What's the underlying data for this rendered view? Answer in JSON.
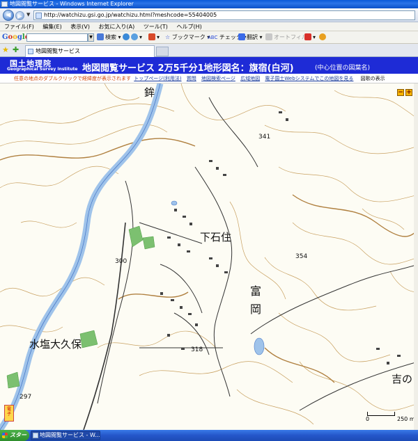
{
  "window": {
    "title": "地図閲覧サービス - Windows Internet Explorer"
  },
  "address": {
    "url": "http://watchizu.gsi.go.jp/watchizu.html?meshcode=55404005"
  },
  "menu": [
    "ファイル(F)",
    "編集(E)",
    "表示(V)",
    "お気に入り(A)",
    "ツール(T)",
    "ヘルプ(H)"
  ],
  "google_toolbar": {
    "logo": [
      "G",
      "o",
      "o",
      "g",
      "l",
      "e"
    ],
    "search_label": "検索",
    "bookmark_label": "ブックマーク",
    "check_label": "チェック",
    "translate_label": "翻訳",
    "autofill_label": "オートフィル"
  },
  "tab": {
    "title": "地図閲覧サービス"
  },
  "gsi": {
    "logo_jp": "国土地理院",
    "logo_en": "Geographical Survey Institute",
    "title": "地図閲覧サービス 2万5千分1地形図名：旗宿(白河)",
    "subtitle": "(中心位置の図葉名)"
  },
  "linkbar": {
    "hint": "任意の地点のダブルクリックで経緯度が表示されます",
    "links": [
      "トップページ(利用法)",
      "質問",
      "地図検索ページ",
      "広域地図",
      "電子国土Webシステムでこの地図を見る"
    ],
    "menu_label": "図歌の表示"
  },
  "map": {
    "labels": {
      "shimoishizumi": "下石住",
      "tomioka": [
        "富",
        "岡"
      ],
      "mizushio": "水塩大久保",
      "yoshino": "吉の",
      "hoko": "鉾"
    },
    "elevations": [
      "341",
      "300",
      "354",
      "318",
      "297"
    ],
    "scale": {
      "zero": "0",
      "value": "250 m"
    },
    "zoom_out": "−",
    "zoom_in": "+",
    "compass_text": [
      "電",
      "子"
    ],
    "colors": {
      "contour": "#c8a060",
      "river": "#9fc3ea",
      "road": "#333333",
      "forest": "#7cc070"
    }
  },
  "taskbar": {
    "start": "スタート",
    "items": [
      "地図閲覧サービス - W..."
    ]
  }
}
